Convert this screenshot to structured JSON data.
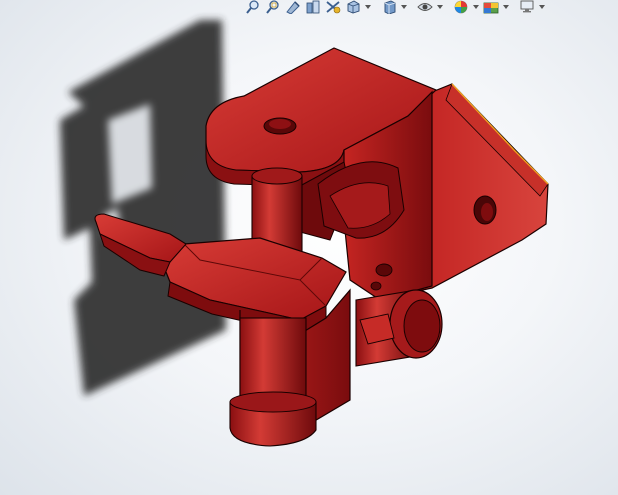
{
  "view": {
    "background_center": "#ffffff",
    "background_edge": "#dde3ea",
    "shadow_color": "#2e2e2e"
  },
  "model": {
    "part_color": "#b0181a",
    "part_highlight": "#d23a35",
    "part_dark": "#6e0a0c",
    "edge_color": "#1a0000",
    "selected_edge_color": "#f0a020"
  },
  "toolbar": {
    "items": [
      {
        "name": "zoom-to-fit-icon",
        "has_dropdown": false
      },
      {
        "name": "zoom-to-area-icon",
        "has_dropdown": false
      },
      {
        "name": "previous-view-icon",
        "has_dropdown": false
      },
      {
        "name": "section-view-icon",
        "has_dropdown": false
      },
      {
        "name": "dynamic-annotation-icon",
        "has_dropdown": false
      },
      {
        "name": "view-orientation-icon",
        "has_dropdown": true
      },
      {
        "name": "display-style-icon",
        "has_dropdown": true
      },
      {
        "name": "hide-show-items-icon",
        "has_dropdown": true
      },
      {
        "name": "edit-appearance-icon",
        "has_dropdown": true
      },
      {
        "name": "apply-scene-icon",
        "has_dropdown": true
      },
      {
        "name": "view-settings-icon",
        "has_dropdown": true
      }
    ]
  }
}
